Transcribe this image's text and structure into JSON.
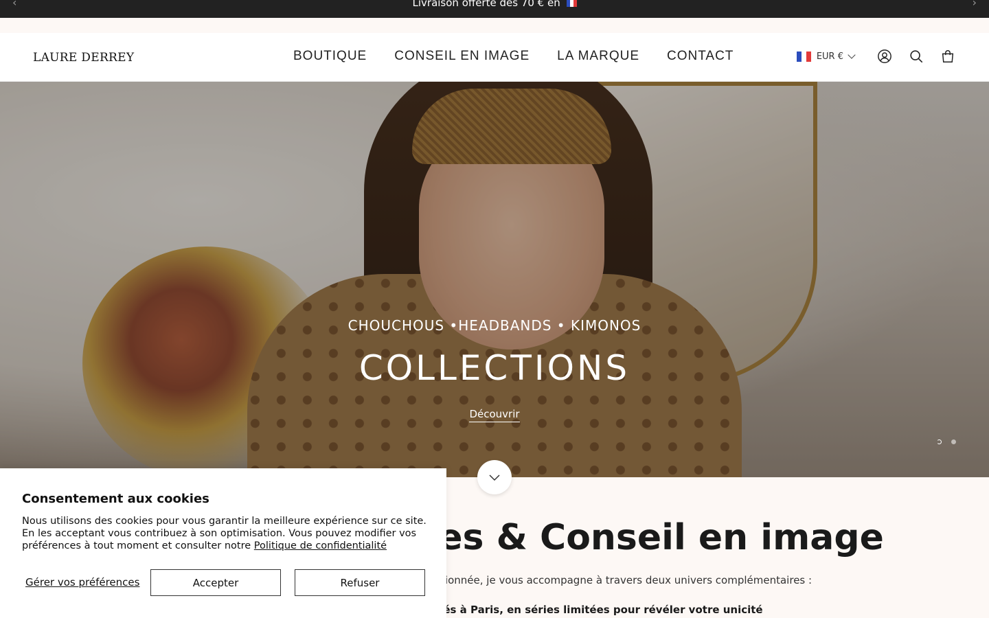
{
  "announcement": {
    "text": "Livraison offerte dès 70 € en",
    "prev_icon": "‹",
    "next_icon": "›"
  },
  "header": {
    "logo": "LAURE DERREY",
    "nav": [
      "BOUTIQUE",
      "CONSEIL EN IMAGE",
      "LA MARQUE",
      "CONTACT"
    ],
    "currency": "EUR €"
  },
  "hero": {
    "subtitle": "CHOUCHOUS •HEADBANDS • KIMONOS",
    "title": "COLLECTIONS",
    "cta": "Découvrir",
    "slide_count": 2,
    "active_slide": 1
  },
  "section": {
    "title": "Accessoires & Conseil en image",
    "intro": "Créatrice et conseillère en image passionnée, je vous accompagne à travers deux univers complémentaires :",
    "bullet": "Des accessoires upcyclés, fabriqués à Paris, en séries limitées pour révéler votre unicité"
  },
  "cookie": {
    "title": "Consentement aux cookies",
    "text": "Nous utilisons des cookies pour vous garantir la meilleure expérience sur ce site. En les acceptant vous contribuez à son optimisation. Vous pouvez modifier vos préférences à tout moment et consulter notre ",
    "policy_link": "Politique de confidentialité",
    "manage": "Gérer vos préférences",
    "accept": "Accepter",
    "refuse": "Refuser"
  },
  "colors": {
    "announcement_bg": "#222222",
    "section_bg": "#fdf8f5",
    "text": "#1c1c1c"
  }
}
